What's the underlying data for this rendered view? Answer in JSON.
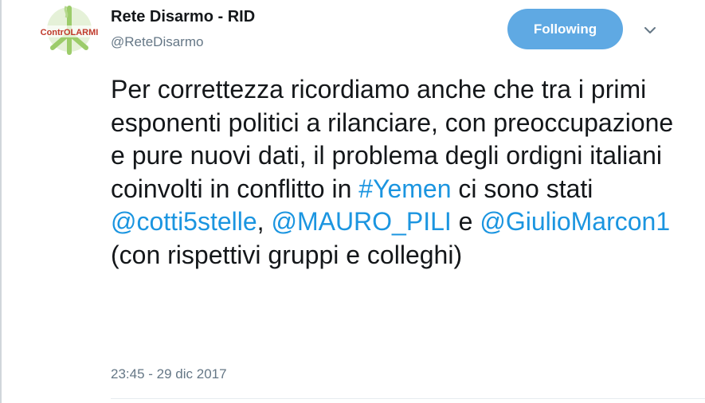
{
  "user": {
    "display_name": "Rete Disarmo - RID",
    "handle": "@ReteDisarmo",
    "avatar_text": "ContrOLARMI"
  },
  "follow": {
    "label": "Following"
  },
  "menu": {
    "icon": "chevron-down-icon"
  },
  "tweet": {
    "text_1": "Per correttezza ricordiamo anche che tra i primi esponenti politici a rilanciare, con preoccupazione e pure nuovi dati, il problema degli ordigni italiani coinvolti in conflitto in ",
    "hashtag": "#Yemen",
    "text_2": " ci sono stati ",
    "mention_1": "@cotti5stelle",
    "text_3": ", ",
    "mention_2": "@MAURO_PILI",
    "text_4": " e ",
    "mention_3": "@GiulioMarcon1",
    "text_5": " (con rispettivi gruppi e colleghi)",
    "timestamp": "23:45 - 29 dic 2017"
  },
  "colors": {
    "link": "#1b95e0",
    "follow_button": "#5fa9e3",
    "secondary_text": "#657786"
  }
}
